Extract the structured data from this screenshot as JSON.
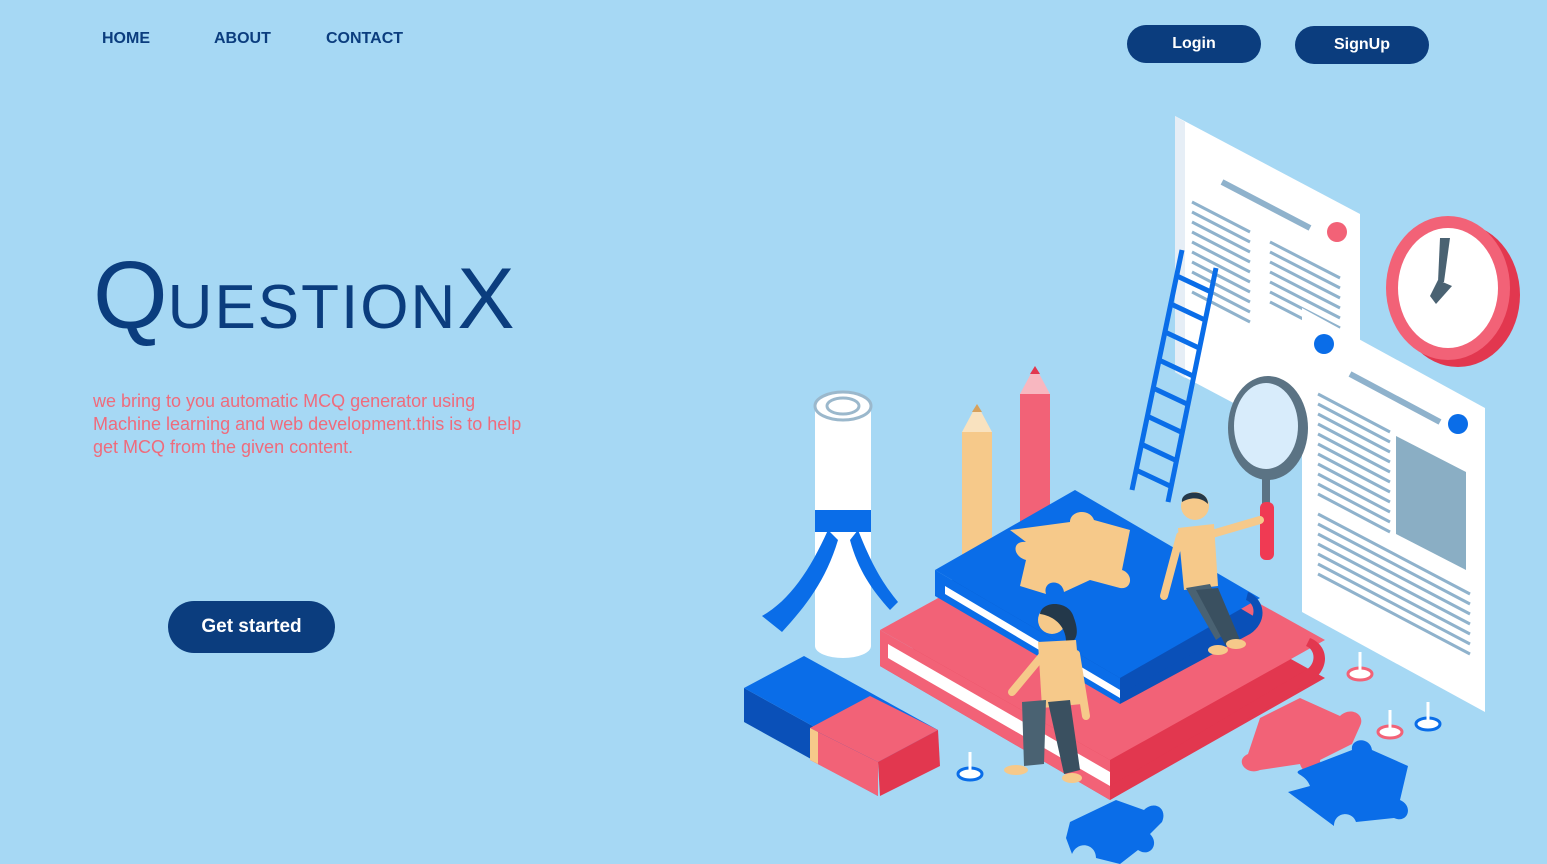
{
  "nav": {
    "home": "HOME",
    "about": "ABOUT",
    "contact": "CONTACT"
  },
  "auth": {
    "login": "Login",
    "signup": "SignUp"
  },
  "hero": {
    "brand_q": "Q",
    "brand_uestion": "UESTION",
    "brand_x": "X",
    "tagline": "we bring to you automatic MCQ generator using Machine learning and web development.this is to help get MCQ from the given content.",
    "cta": "Get started"
  },
  "colors": {
    "background": "#a6d8f4",
    "primary": "#0b3d7e",
    "accent_text": "#ef6b7c",
    "blue": "#0a6de8",
    "red": "#f26277",
    "yellow": "#f6c98a"
  }
}
